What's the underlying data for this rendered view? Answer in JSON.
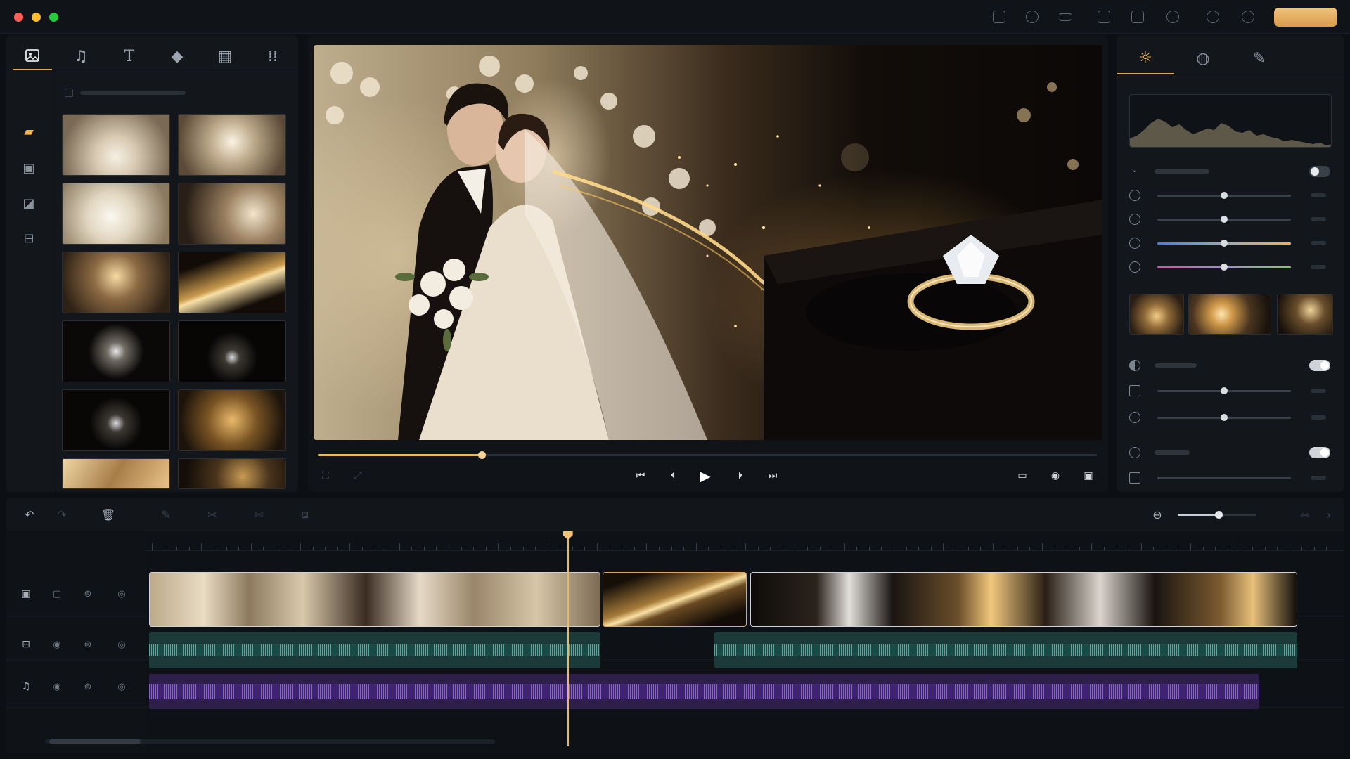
{
  "titlebar": {
    "icons": [
      "message-square-icon",
      "search-plus-icon",
      "menu-icon",
      "share-out-icon",
      "download-icon",
      "settings-search-icon",
      "chat-icon",
      "refresh-icon"
    ],
    "export_button": ""
  },
  "media_panel": {
    "tabs": [
      "image-icon",
      "music-icon",
      "text-icon",
      "fill-icon",
      "layout-icon",
      "more-grid-icon"
    ],
    "active_tab": 0,
    "rail": [
      "folder-icon",
      "photo-icon",
      "gallery-icon",
      "caption-icon"
    ],
    "thumbnails": [
      "bride-bouquet",
      "wedding-aisle",
      "white-bouquet",
      "couple-closeup",
      "reception-hall",
      "gold-light-streak",
      "diamond-ring",
      "diamond-necklace",
      "diamond-earrings",
      "golden-bokeh",
      "gold-fabric",
      "gold-sparkle"
    ]
  },
  "preview": {
    "scene": "wedding-couple-and-diamond-ring",
    "progress_fraction": 0.21,
    "controls": [
      "skip-start-icon",
      "step-back-icon",
      "play-icon",
      "step-forward-icon",
      "skip-end-icon"
    ],
    "left_tools": [
      "fit-icon",
      "fullscreen-icon"
    ],
    "right_tools": [
      "monitor-icon",
      "camera-icon",
      "screenshot-icon"
    ]
  },
  "adjust_panel": {
    "tabs": [
      "sun-icon",
      "color-wheel-icon",
      "brush-icon"
    ],
    "active_tab": 0,
    "sliders_top": [
      {
        "icon": "brightness-icon",
        "value": 0.5,
        "track": "neutral"
      },
      {
        "icon": "contrast-icon",
        "value": 0.5,
        "track": "neutral"
      },
      {
        "icon": "temperature-icon",
        "value": 0.5,
        "track": "temperature"
      },
      {
        "icon": "tint-icon",
        "value": 0.5,
        "track": "tint"
      }
    ],
    "sliders_bottom": [
      {
        "icon": "vignette-icon",
        "value": 0.5
      },
      {
        "icon": "circle-icon",
        "value": 0.5
      }
    ],
    "section_toggles": [
      false,
      true,
      true
    ],
    "preset_thumbs": [
      "golden-dust",
      "starburst",
      "sparkle-dark"
    ]
  },
  "timeline": {
    "tools_left": [
      "undo-icon",
      "redo-icon",
      "delete-icon",
      "edit-icon",
      "cut-icon",
      "split-icon",
      "crop-icon"
    ],
    "zoom_fraction": 0.52,
    "ruler_ticks": 24,
    "playhead_fraction": 0.361,
    "tracks": [
      {
        "kind": "video",
        "icons": [
          "video-track-icon",
          "film-icon",
          "lock-icon",
          "target-icon"
        ]
      },
      {
        "kind": "audio",
        "icons": [
          "caption-track-icon",
          "eye-icon",
          "lock-icon",
          "target-icon"
        ]
      },
      {
        "kind": "music",
        "icons": [
          "music-track-icon",
          "eye-icon",
          "lock-icon",
          "target-icon"
        ]
      }
    ],
    "video_clips": [
      {
        "name": "ceremony-clip",
        "start": 0.0,
        "end": 0.389
      },
      {
        "name": "gold-streak-clip",
        "start": 0.391,
        "end": 0.515
      },
      {
        "name": "ring-clip",
        "start": 0.518,
        "end": 0.99
      }
    ],
    "audio_clips": [
      {
        "start": 0.0,
        "end": 0.389
      },
      {
        "start": 0.487,
        "end": 0.99
      }
    ],
    "music_clip": {
      "start": 0.0,
      "end": 0.957
    }
  }
}
